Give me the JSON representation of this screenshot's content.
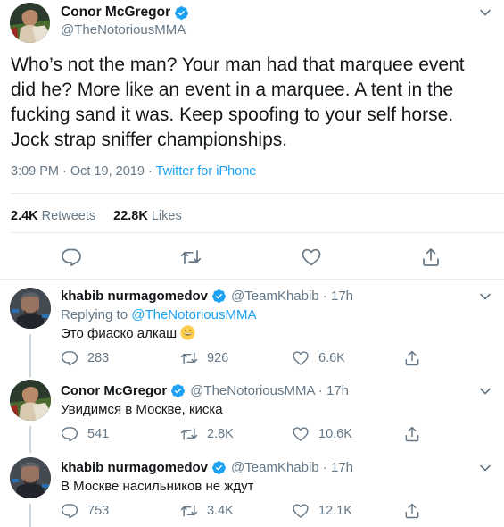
{
  "main_tweet": {
    "author_name": "Conor McGregor",
    "handle": "@TheNotoriousMMA",
    "text_lines": [
      "Who’s not the man? Your man had that marquee event",
      "did he? More like an event in a marquee. A tent in the",
      "fucking sand it was. Keep spoofing to your self horse.",
      "Jock strap sniffer championships."
    ],
    "time": "3:09 PM · Oct 19, 2019 · ",
    "source": "Twitter for iPhone",
    "retweets_count": "2.4K",
    "retweets_label": "Retweets",
    "likes_count": "22.8K",
    "likes_label": "Likes"
  },
  "replies": [
    {
      "author_name": "khabib nurmagomedov",
      "handle_time": "@TeamKhabib · 17h",
      "replying_prefix": "Replying to ",
      "replying_to": "@TheNotoriousMMA",
      "text": "Это фиаско алкаш",
      "emoji": "grinning-face",
      "reply_count": "283",
      "retweet_count": "926",
      "like_count": "6.6K"
    },
    {
      "author_name": "Conor McGregor",
      "handle_time": "@TheNotoriousMMA · 17h",
      "text": "Увидимся в Москве, киска",
      "reply_count": "541",
      "retweet_count": "2.8K",
      "like_count": "10.6K"
    },
    {
      "author_name": "khabib nurmagomedov",
      "handle_time": "@TeamKhabib · 17h",
      "text": "В Москве насильников не ждут",
      "reply_count": "753",
      "retweet_count": "3.4K",
      "like_count": "12.1K"
    }
  ],
  "colors": {
    "accent": "#1da1f2",
    "secondary_text": "#657786",
    "icon": "#657786",
    "thread_line": "#ccd6dd"
  }
}
